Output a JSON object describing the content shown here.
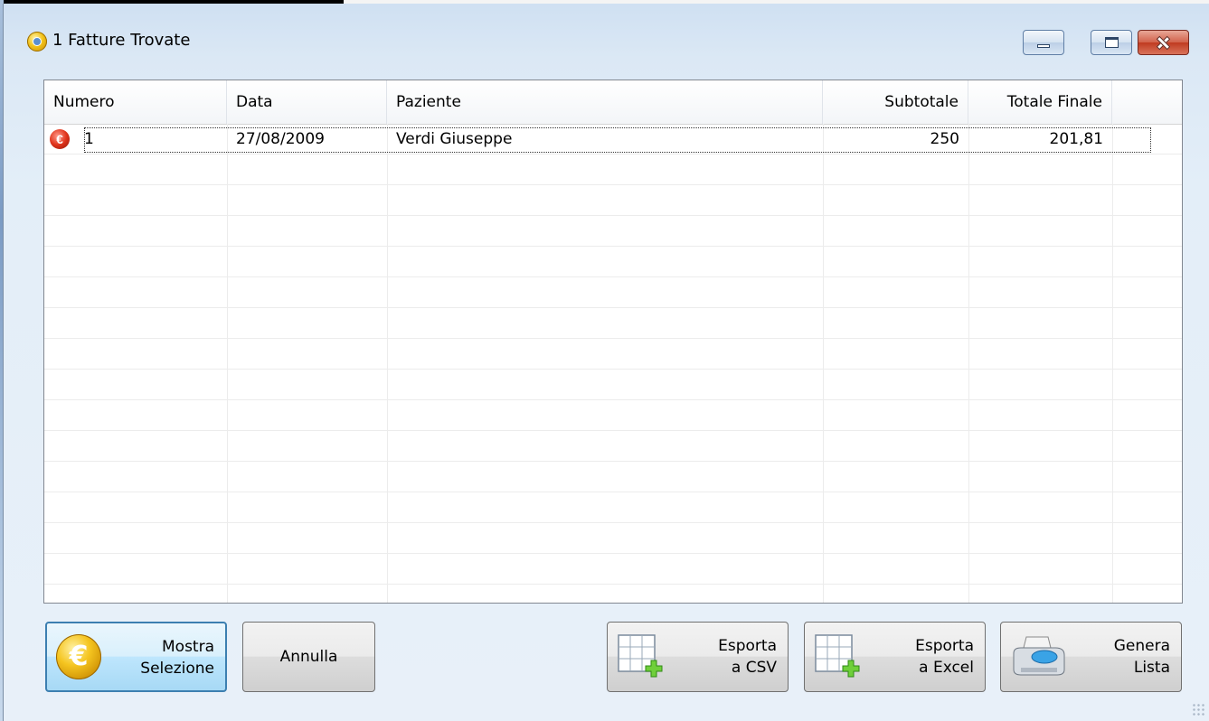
{
  "window": {
    "title": "1 Fatture Trovate"
  },
  "grid": {
    "columns": [
      "Numero",
      "Data",
      "Paziente",
      "Subtotale",
      "Totale Finale"
    ],
    "rows": [
      {
        "numero": "1",
        "data": "27/08/2009",
        "paziente": "Verdi Giuseppe",
        "subtotale": "250",
        "totale": "201,81",
        "icon": "euro-red-icon"
      }
    ]
  },
  "buttons": {
    "mostra": {
      "line1": "Mostra",
      "line2": "Selezione",
      "icon": "euro-coin-icon"
    },
    "annulla": {
      "label": "Annulla"
    },
    "csv": {
      "line1": "Esporta",
      "line2": "a CSV",
      "icon": "table-add-icon"
    },
    "excel": {
      "line1": "Esporta",
      "line2": "a Excel",
      "icon": "table-add-icon"
    },
    "genera": {
      "line1": "Genera",
      "line2": "Lista",
      "icon": "printer-icon"
    }
  }
}
